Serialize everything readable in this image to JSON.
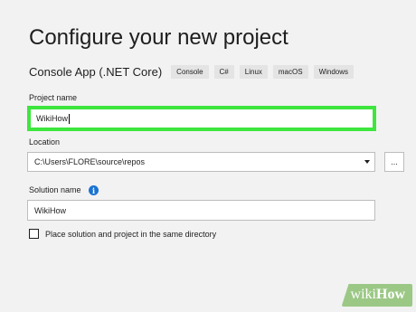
{
  "page": {
    "title": "Configure your new project",
    "app_type": "Console App (.NET Core)",
    "tags": [
      "Console",
      "C#",
      "Linux",
      "macOS",
      "Windows"
    ]
  },
  "project_name": {
    "label": "Project name",
    "value": "WikiHow"
  },
  "location": {
    "label": "Location",
    "value": "C:\\Users\\FLORE\\source\\repos",
    "browse_label": "..."
  },
  "solution_name": {
    "label": "Solution name",
    "value": "WikiHow",
    "info_icon": "i"
  },
  "same_directory": {
    "label": "Place solution and project in the same directory",
    "checked": false
  },
  "watermark": {
    "wiki": "wiki",
    "how": "How"
  },
  "colors": {
    "highlight": "#3ee63e",
    "info": "#1a73d1",
    "watermark_bg": "#9cc886"
  }
}
